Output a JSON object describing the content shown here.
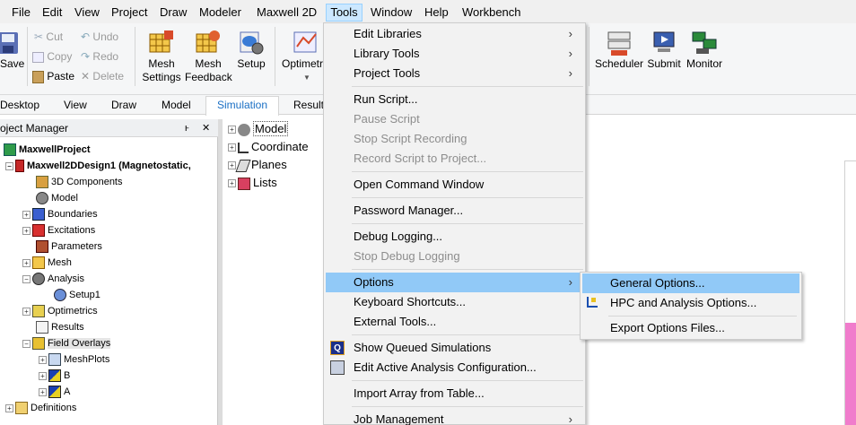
{
  "menubar": {
    "items": [
      "File",
      "Edit",
      "View",
      "Project",
      "Draw",
      "Modeler",
      "Maxwell 2D",
      "Tools",
      "Window",
      "Help",
      "Workbench"
    ],
    "active": "Tools"
  },
  "ribbon": {
    "save": "Save",
    "cut": "Cut",
    "copy": "Copy",
    "paste": "Paste",
    "undo": "Undo",
    "redo": "Redo",
    "delete": "Delete",
    "mesh_settings": [
      "Mesh",
      "Settings"
    ],
    "mesh_feedback": [
      "Mesh",
      "Feedback"
    ],
    "setup": "Setup",
    "optimetrics": "Optimetr",
    "scheduler": "Scheduler",
    "submit": "Submit",
    "monitor": "Monitor"
  },
  "ribbon_tabs": {
    "items": [
      "Desktop",
      "View",
      "Draw",
      "Model",
      "Simulation",
      "Result"
    ],
    "active": "Simulation"
  },
  "project_manager": {
    "title": "oject Manager",
    "pin": "ⱶ",
    "close": "✕",
    "rows": [
      {
        "label": "MaxwellProject",
        "bold": true
      },
      {
        "label": "Maxwell2DDesign1 (Magnetostatic,",
        "bold": true
      },
      {
        "label": "3D Components"
      },
      {
        "label": "Model"
      },
      {
        "label": "Boundaries"
      },
      {
        "label": "Excitations"
      },
      {
        "label": "Parameters"
      },
      {
        "label": "Mesh"
      },
      {
        "label": "Analysis"
      },
      {
        "label": "Setup1"
      },
      {
        "label": "Optimetrics"
      },
      {
        "label": "Results"
      },
      {
        "label": "Field Overlays"
      },
      {
        "label": "MeshPlots"
      },
      {
        "label": "B"
      },
      {
        "label": "A"
      },
      {
        "label": "Definitions"
      }
    ]
  },
  "model_tree": {
    "rows": [
      "Model",
      "Coordinate",
      "Planes",
      "Lists"
    ]
  },
  "tools_menu": {
    "items": [
      {
        "label": "Edit Libraries",
        "submenu": true
      },
      {
        "label": "Library Tools",
        "submenu": true
      },
      {
        "label": "Project Tools",
        "submenu": true
      },
      {
        "label": "Run Script..."
      },
      {
        "label": "Pause Script",
        "disabled": true
      },
      {
        "label": "Stop Script Recording",
        "disabled": true
      },
      {
        "label": "Record Script to Project...",
        "disabled": true
      },
      {
        "label": "Open Command Window"
      },
      {
        "label": "Password Manager..."
      },
      {
        "label": "Debug Logging..."
      },
      {
        "label": "Stop Debug Logging",
        "disabled": true
      },
      {
        "label": "Options",
        "submenu": true,
        "highlighted": true
      },
      {
        "label": "Keyboard Shortcuts..."
      },
      {
        "label": "External Tools..."
      },
      {
        "label": "Show Queued Simulations",
        "icon": "queue-icon"
      },
      {
        "label": "Edit Active Analysis Configuration...",
        "icon": "analysis-config-icon"
      },
      {
        "label": "Import Array from Table..."
      },
      {
        "label": "Job Management",
        "submenu": true
      }
    ],
    "submenu_arrow": "›"
  },
  "options_submenu": {
    "items": [
      {
        "label": "General Options...",
        "highlighted": true
      },
      {
        "label": "HPC and Analysis Options...",
        "icon": "hpc-icon"
      },
      {
        "label": "Export Options Files..."
      }
    ]
  },
  "colors": {
    "menu_highlight": "#91c9f7",
    "active_tab_text": "#1a6fc4",
    "disabled_text": "#8d8d8d",
    "canvas_pink": "#f07ccc"
  }
}
